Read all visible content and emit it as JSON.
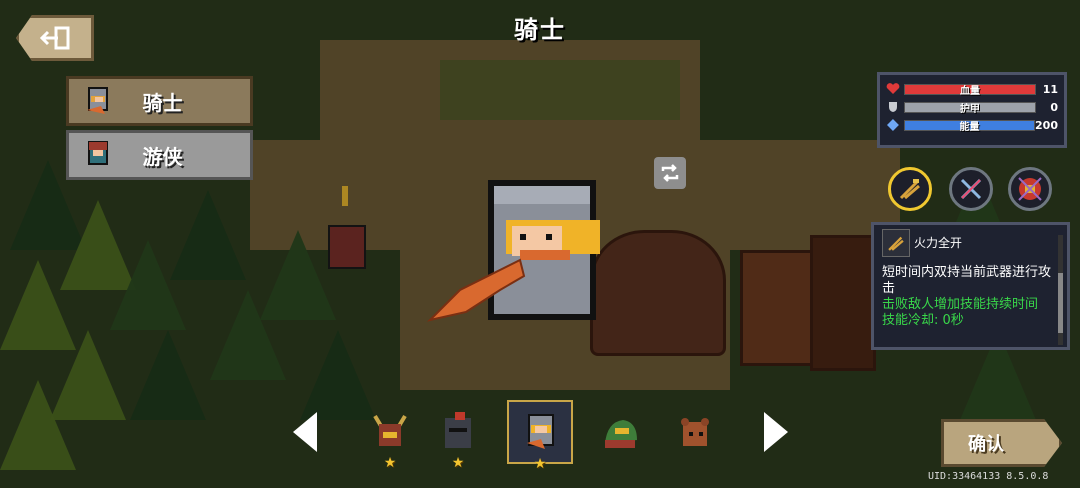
{
  "header": {
    "title": "骑士",
    "back_icon": "exit-icon"
  },
  "characters": [
    {
      "label": "骑士",
      "icon": "knight-avatar",
      "active": true
    },
    {
      "label": "游侠",
      "icon": "rogue-avatar",
      "active": false
    }
  ],
  "stats": [
    {
      "label": "血量",
      "value": "11",
      "icon": "heart-icon",
      "color": "#e03a3a",
      "fraction": 1.0
    },
    {
      "label": "护甲",
      "value": "0",
      "icon": "shield-icon",
      "color": "#9ea3ab",
      "fraction": 1.0
    },
    {
      "label": "能量",
      "value": "200",
      "icon": "energy-gem-icon",
      "color": "#3f7fe0",
      "fraction": 1.0
    }
  ],
  "skills": [
    {
      "icon": "dual-wield-icon",
      "selected": true
    },
    {
      "icon": "crossed-swords-icon",
      "selected": false
    },
    {
      "icon": "gladiator-helmet-icon",
      "selected": false
    }
  ],
  "skill_card": {
    "name": "火力全开",
    "desc": "短时间内双持当前武器进行攻击",
    "bonus": "击败敌人增加技能持续时间",
    "cooldown": "技能冷却: 0秒"
  },
  "skins": [
    {
      "icon": "horned-knight-skin",
      "stars": "★"
    },
    {
      "icon": "dark-knight-skin",
      "stars": "★"
    },
    {
      "icon": "default-knight-skin",
      "stars": "★",
      "selected": true
    },
    {
      "icon": "green-knight-skin",
      "stars": ""
    },
    {
      "icon": "bear-knight-skin",
      "stars": ""
    }
  ],
  "confirm_label": "确认",
  "uid_text": "UID:33464133 8.5.0.8",
  "colors": {
    "accent": "#f0c830",
    "panel": "#1e2230",
    "button": "#b9a57e"
  }
}
